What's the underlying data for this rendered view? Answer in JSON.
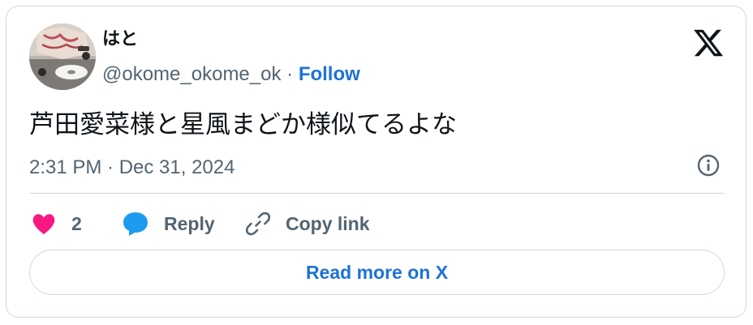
{
  "author": {
    "display_name": "はと",
    "handle": "@okome_okome_ok",
    "separator": " · ",
    "follow_label": "Follow"
  },
  "tweet": {
    "text": "芦田愛菜様と星風まどか様似てるよな",
    "timestamp": "2:31 PM · Dec 31, 2024"
  },
  "actions": {
    "like_count": "2",
    "reply_label": "Reply",
    "copy_link_label": "Copy link"
  },
  "read_more_label": "Read more on X",
  "colors": {
    "link_blue": "#1d72d6",
    "like_pink": "#f91880",
    "reply_blue": "#1d9bf0",
    "muted_gray": "#536471",
    "border": "#cfd9de"
  },
  "icons": [
    "avatar-image",
    "x-logo-icon",
    "info-icon",
    "heart-icon",
    "reply-bubble-icon",
    "link-icon"
  ]
}
